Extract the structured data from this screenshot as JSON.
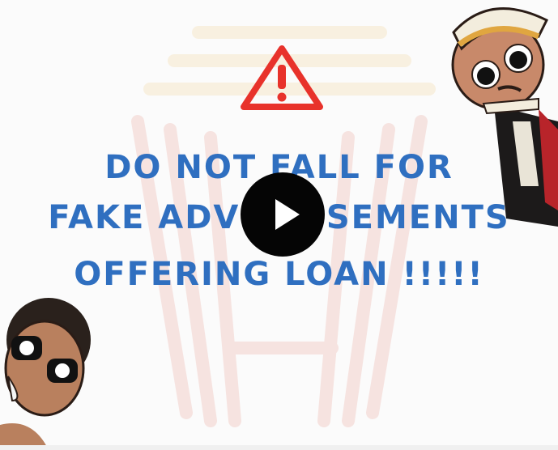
{
  "video": {
    "headline": {
      "line1": "DO NOT FALL FOR",
      "line2": "FAKE ADVERTISEMENTS",
      "line3": "OFFERING LOAN !!!!!"
    },
    "play_icon": "play-icon",
    "warning_icon": "warning-triangle-icon"
  },
  "colors": {
    "headline": "#2f6fc0",
    "warning": "#e8322b",
    "play_button": "#050505"
  }
}
